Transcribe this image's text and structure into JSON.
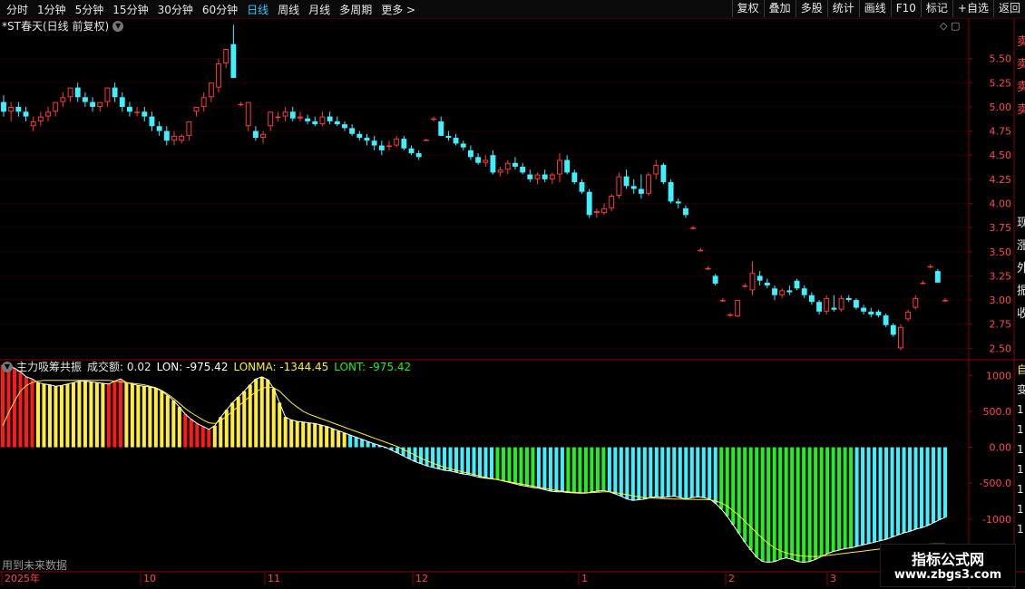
{
  "toolbar": {
    "periods": [
      "分时",
      "1分钟",
      "5分钟",
      "15分钟",
      "30分钟",
      "60分钟",
      "日线",
      "周线",
      "月线",
      "多周期",
      "更多 >"
    ],
    "active_index": 6,
    "actions": [
      "复权",
      "叠加",
      "多股",
      "统计",
      "画线",
      "F10",
      "标记",
      "+自选",
      "返回"
    ]
  },
  "main": {
    "title": "*ST春天(日线 前复权)",
    "icons_text": "◇ ▢",
    "y_ticks": [
      "5.50",
      "5.25",
      "5.00",
      "4.75",
      "4.50",
      "4.25",
      "4.00",
      "3.75",
      "3.50",
      "3.25",
      "3.00",
      "2.75",
      "2.50"
    ],
    "y_values": [
      5.5,
      5.25,
      5.0,
      4.75,
      4.5,
      4.25,
      4.0,
      3.75,
      3.5,
      3.25,
      3.0,
      2.75,
      2.5
    ],
    "side_chars": [
      "卖",
      "卖",
      "卖",
      "卖",
      "现",
      "涨",
      "外",
      "振",
      "收"
    ]
  },
  "indicator": {
    "name": "主力吸筹共振",
    "vol_text": "成交额: 0.02",
    "lon_text": "LON: -975.42",
    "lonma_text": "LONMA: -1344.45",
    "lont_text": "LONT: -975.42",
    "y_ticks": [
      "1000",
      "500.0",
      "0.00",
      "-500.0",
      "-1000"
    ],
    "y_values": [
      1000,
      500,
      0,
      -500,
      -1000
    ],
    "side_chars": [
      "自",
      "变",
      "1",
      "1",
      "1",
      "1",
      "1",
      "1",
      "1"
    ]
  },
  "x_axis": {
    "labels": [
      "2025年",
      "10",
      "11",
      "12",
      "1",
      "2",
      "3"
    ]
  },
  "future_text": "用到未来数据",
  "watermark": {
    "line1": "指标公式网",
    "line2": "www.zbgs3.com"
  },
  "colors": {
    "up": "#ff3a3a",
    "down": "#3ff0ff",
    "red_bar": "#ff1a1a",
    "yellow_bar": "#ffee33",
    "cyan_bar": "#3ff0ff",
    "green_bar": "#22ee22",
    "axis_line": "#8a0000"
  },
  "chart_data": [
    {
      "type": "candlestick",
      "title": "*ST春天(日线 前复权)",
      "ylim": [
        2.4,
        5.75
      ],
      "candles": [
        [
          5.05,
          5.12,
          4.9,
          4.95
        ],
        [
          4.95,
          5.05,
          4.85,
          5.0
        ],
        [
          5.0,
          5.05,
          4.9,
          4.95
        ],
        [
          4.95,
          5.0,
          4.85,
          4.9
        ],
        [
          4.8,
          4.9,
          4.75,
          4.85
        ],
        [
          4.85,
          4.95,
          4.8,
          4.9
        ],
        [
          4.9,
          5.0,
          4.85,
          4.95
        ],
        [
          4.95,
          5.05,
          4.9,
          5.05
        ],
        [
          5.05,
          5.15,
          5.0,
          5.1
        ],
        [
          5.1,
          5.2,
          5.05,
          5.2
        ],
        [
          5.2,
          5.25,
          5.05,
          5.1
        ],
        [
          5.1,
          5.15,
          5.0,
          5.05
        ],
        [
          5.05,
          5.1,
          4.95,
          5.0
        ],
        [
          5.0,
          5.05,
          4.95,
          5.05
        ],
        [
          5.05,
          5.2,
          5.0,
          5.2
        ],
        [
          5.2,
          5.25,
          5.05,
          5.1
        ],
        [
          5.1,
          5.15,
          4.95,
          5.0
        ],
        [
          5.0,
          5.05,
          4.9,
          4.95
        ],
        [
          4.95,
          5.0,
          4.9,
          4.95
        ],
        [
          4.95,
          5.0,
          4.85,
          4.9
        ],
        [
          4.9,
          4.95,
          4.75,
          4.8
        ],
        [
          4.8,
          4.85,
          4.7,
          4.75
        ],
        [
          4.75,
          4.8,
          4.6,
          4.65
        ],
        [
          4.65,
          4.75,
          4.6,
          4.7
        ],
        [
          4.65,
          4.72,
          4.62,
          4.7
        ],
        [
          4.7,
          4.85,
          4.65,
          4.85
        ],
        [
          4.95,
          5.0,
          4.9,
          5.0
        ],
        [
          5.0,
          5.15,
          4.95,
          5.1
        ],
        [
          5.1,
          5.25,
          5.05,
          5.25
        ],
        [
          5.2,
          5.5,
          5.15,
          5.45
        ],
        [
          5.45,
          5.6,
          5.4,
          5.6
        ],
        [
          5.65,
          5.85,
          5.3,
          5.3
        ],
        [
          5.03,
          5.05,
          5.01,
          5.03
        ],
        [
          4.8,
          5.05,
          4.75,
          5.05
        ],
        [
          4.75,
          4.8,
          4.65,
          4.68
        ],
        [
          4.68,
          4.75,
          4.62,
          4.72
        ],
        [
          4.8,
          4.95,
          4.75,
          4.95
        ],
        [
          4.9,
          4.95,
          4.85,
          4.9
        ],
        [
          4.9,
          5.0,
          4.85,
          4.95
        ],
        [
          4.95,
          5.0,
          4.85,
          4.88
        ],
        [
          4.88,
          4.95,
          4.85,
          4.9
        ],
        [
          4.88,
          4.92,
          4.82,
          4.85
        ],
        [
          4.85,
          4.9,
          4.8,
          4.82
        ],
        [
          4.82,
          4.95,
          4.8,
          4.9
        ],
        [
          4.9,
          4.95,
          4.82,
          4.85
        ],
        [
          4.85,
          4.9,
          4.8,
          4.82
        ],
        [
          4.82,
          4.85,
          4.75,
          4.78
        ],
        [
          4.78,
          4.82,
          4.7,
          4.72
        ],
        [
          4.72,
          4.75,
          4.65,
          4.68
        ],
        [
          4.68,
          4.72,
          4.6,
          4.65
        ],
        [
          4.65,
          4.7,
          4.55,
          4.6
        ],
        [
          4.6,
          4.65,
          4.5,
          4.55
        ],
        [
          4.6,
          4.65,
          4.55,
          4.6
        ],
        [
          4.6,
          4.7,
          4.58,
          4.67
        ],
        [
          4.67,
          4.7,
          4.55,
          4.57
        ],
        [
          4.57,
          4.6,
          4.5,
          4.52
        ],
        [
          4.52,
          4.55,
          4.45,
          4.48
        ],
        [
          4.66,
          4.67,
          4.65,
          4.66
        ],
        [
          4.88,
          4.9,
          4.85,
          4.88
        ],
        [
          4.85,
          4.9,
          4.7,
          4.7
        ],
        [
          4.7,
          4.75,
          4.65,
          4.68
        ],
        [
          4.68,
          4.72,
          4.6,
          4.62
        ],
        [
          4.62,
          4.65,
          4.55,
          4.58
        ],
        [
          4.55,
          4.6,
          4.45,
          4.48
        ],
        [
          4.48,
          4.52,
          4.4,
          4.42
        ],
        [
          4.42,
          4.5,
          4.38,
          4.45
        ],
        [
          4.5,
          4.55,
          4.3,
          4.32
        ],
        [
          4.32,
          4.38,
          4.28,
          4.35
        ],
        [
          4.35,
          4.45,
          4.3,
          4.42
        ],
        [
          4.42,
          4.48,
          4.35,
          4.38
        ],
        [
          4.38,
          4.42,
          4.3,
          4.32
        ],
        [
          4.3,
          4.35,
          4.22,
          4.25
        ],
        [
          4.25,
          4.32,
          4.2,
          4.3
        ],
        [
          4.3,
          4.35,
          4.22,
          4.25
        ],
        [
          4.25,
          4.32,
          4.2,
          4.3
        ],
        [
          4.3,
          4.52,
          4.22,
          4.45
        ],
        [
          4.45,
          4.5,
          4.3,
          4.32
        ],
        [
          4.32,
          4.35,
          4.2,
          4.22
        ],
        [
          4.22,
          4.25,
          4.1,
          4.12
        ],
        [
          4.12,
          4.15,
          3.85,
          3.88
        ],
        [
          3.9,
          3.95,
          3.85,
          3.92
        ],
        [
          3.9,
          4.0,
          3.88,
          3.95
        ],
        [
          3.95,
          4.1,
          3.92,
          4.08
        ],
        [
          4.08,
          4.32,
          4.05,
          4.28
        ],
        [
          4.28,
          4.35,
          4.15,
          4.18
        ],
        [
          4.18,
          4.25,
          4.1,
          4.15
        ],
        [
          4.15,
          4.3,
          4.05,
          4.1
        ],
        [
          4.1,
          4.32,
          4.08,
          4.3
        ],
        [
          4.3,
          4.45,
          4.25,
          4.4
        ],
        [
          4.4,
          4.42,
          4.2,
          4.22
        ],
        [
          4.22,
          4.25,
          4.0,
          4.02
        ],
        [
          4.02,
          4.05,
          3.95,
          4.0
        ],
        [
          3.95,
          3.98,
          3.85,
          3.88
        ],
        [
          3.75,
          3.77,
          3.73,
          3.75
        ],
        [
          3.52,
          3.54,
          3.5,
          3.52
        ],
        [
          3.33,
          3.35,
          3.31,
          3.33
        ],
        [
          3.25,
          3.27,
          3.15,
          3.17
        ],
        [
          3.0,
          3.02,
          2.98,
          3.0
        ],
        [
          2.85,
          2.87,
          2.83,
          2.85
        ],
        [
          2.83,
          3.0,
          2.82,
          3.0
        ],
        [
          3.15,
          3.17,
          3.13,
          3.15
        ],
        [
          3.1,
          3.4,
          3.05,
          3.28
        ],
        [
          3.25,
          3.3,
          3.15,
          3.2
        ],
        [
          3.18,
          3.22,
          3.12,
          3.15
        ],
        [
          3.12,
          3.15,
          3.0,
          3.05
        ],
        [
          3.05,
          3.12,
          3.02,
          3.1
        ],
        [
          3.1,
          3.15,
          3.05,
          3.08
        ],
        [
          3.2,
          3.22,
          3.1,
          3.12
        ],
        [
          3.12,
          3.15,
          3.02,
          3.05
        ],
        [
          3.05,
          3.08,
          2.95,
          2.98
        ],
        [
          2.98,
          3.0,
          2.85,
          2.88
        ],
        [
          2.88,
          3.05,
          2.85,
          3.02
        ],
        [
          2.92,
          3.05,
          2.88,
          2.9
        ],
        [
          2.9,
          3.05,
          2.88,
          3.02
        ],
        [
          3.02,
          3.05,
          2.98,
          3.0
        ],
        [
          3.0,
          3.02,
          2.9,
          2.92
        ],
        [
          2.92,
          2.95,
          2.85,
          2.88
        ],
        [
          2.88,
          2.92,
          2.82,
          2.85
        ],
        [
          2.88,
          2.9,
          2.82,
          2.84
        ],
        [
          2.84,
          2.86,
          2.72,
          2.74
        ],
        [
          2.74,
          2.76,
          2.62,
          2.64
        ],
        [
          2.5,
          2.75,
          2.48,
          2.72
        ],
        [
          2.8,
          2.9,
          2.78,
          2.88
        ],
        [
          2.92,
          3.05,
          2.9,
          3.02
        ],
        [
          3.18,
          3.2,
          3.16,
          3.18
        ],
        [
          3.35,
          3.37,
          3.33,
          3.35
        ],
        [
          3.3,
          3.32,
          3.18,
          3.18
        ],
        [
          3.0,
          3.02,
          2.98,
          3.0
        ]
      ]
    },
    {
      "type": "bar",
      "title": "主力吸筹共振",
      "ylim": [
        -1720,
        1180
      ],
      "series": [
        {
          "name": "LON",
          "colors_by_bar": "R=red,Y=yellow,C=cyan,G=green",
          "bar_color_codes": "RRRRRRYYYYYYYYYYYYRRRYYYYYYYYYYRRRRRYYYYYYYYYYYYYYYYYYYYYYYCCCCCCCCCCCCCCCCCCCCCCCCCGGGGGGGCCCCCGGGGGGGCCCCCCCCCCCCCCCCCCCGGGGGGGGGGGGGGGGGGGGGGG",
          "values": [
            1150,
            1130,
            1100,
            1050,
            980,
            950,
            900,
            880,
            870,
            850,
            860,
            880,
            900,
            920,
            920,
            910,
            900,
            890,
            880,
            920,
            950,
            900,
            880,
            860,
            850,
            840,
            820,
            780,
            720,
            650,
            560,
            460,
            390,
            330,
            290,
            250,
            300,
            420,
            520,
            620,
            700,
            780,
            870,
            950,
            980,
            940,
            820,
            620,
            420,
            380,
            360,
            350,
            340,
            330,
            310,
            290,
            260,
            230,
            200,
            170,
            140,
            110,
            80,
            50,
            25,
            0,
            -40,
            -80,
            -120,
            -160,
            -200,
            -230,
            -260,
            -280,
            -300,
            -320,
            -330,
            -350,
            -370,
            -380,
            -400,
            -420,
            -430,
            -440,
            -450,
            -470,
            -490,
            -510,
            -530,
            -545,
            -560,
            -570,
            -590,
            -610,
            -620,
            -620,
            -630,
            -635,
            -640,
            -640,
            -620,
            -610,
            -600,
            -620,
            -650,
            -680,
            -720,
            -740,
            -730,
            -720,
            -700,
            -690,
            -700,
            -690,
            -680,
            -700,
            -720,
            -700,
            -690,
            -700,
            -720,
            -780,
            -860,
            -960,
            -1080,
            -1200,
            -1320,
            -1430,
            -1530,
            -1590,
            -1600,
            -1590,
            -1560,
            -1540,
            -1560,
            -1590,
            -1600,
            -1590,
            -1560,
            -1520,
            -1480,
            -1450,
            -1430,
            -1410,
            -1400,
            -1380,
            -1360,
            -1340,
            -1320,
            -1300,
            -1280,
            -1250,
            -1220,
            -1190,
            -1170,
            -1140,
            -1120,
            -1090,
            -1050,
            -1010,
            -975
          ]
        },
        {
          "name": "LONMA",
          "values": [
            300,
            480,
            640,
            780,
            860,
            900,
            920,
            930,
            930,
            930,
            930,
            930,
            930,
            930,
            930,
            930,
            930,
            930,
            930,
            920,
            910,
            900,
            890,
            880,
            870,
            850,
            830,
            790,
            740,
            680,
            610,
            540,
            480,
            430,
            380,
            340,
            330,
            370,
            430,
            500,
            570,
            640,
            710,
            770,
            820,
            840,
            830,
            780,
            700,
            620,
            560,
            500,
            460,
            430,
            400,
            370,
            340,
            310,
            280,
            250,
            220,
            190,
            160,
            130,
            100,
            70,
            40,
            10,
            -30,
            -70,
            -110,
            -150,
            -190,
            -220,
            -250,
            -280,
            -300,
            -320,
            -340,
            -360,
            -380,
            -400,
            -420,
            -435,
            -450,
            -465,
            -480,
            -495,
            -510,
            -525,
            -540,
            -555,
            -570,
            -585,
            -600,
            -610,
            -620,
            -625,
            -630,
            -635,
            -630,
            -625,
            -620,
            -620,
            -630,
            -645,
            -660,
            -675,
            -690,
            -700,
            -705,
            -710,
            -715,
            -718,
            -720,
            -722,
            -724,
            -725,
            -726,
            -727,
            -730,
            -745,
            -775,
            -820,
            -880,
            -950,
            -1030,
            -1110,
            -1190,
            -1270,
            -1340,
            -1400,
            -1440,
            -1470,
            -1490,
            -1505,
            -1515,
            -1520,
            -1520,
            -1515,
            -1505,
            -1495,
            -1485,
            -1475,
            -1465,
            -1455,
            -1445,
            -1435,
            -1425,
            -1415,
            -1405,
            -1395,
            -1385,
            -1375,
            -1365,
            -1355,
            -1350,
            -1348,
            -1346,
            -1345,
            -1344
          ]
        }
      ]
    }
  ]
}
